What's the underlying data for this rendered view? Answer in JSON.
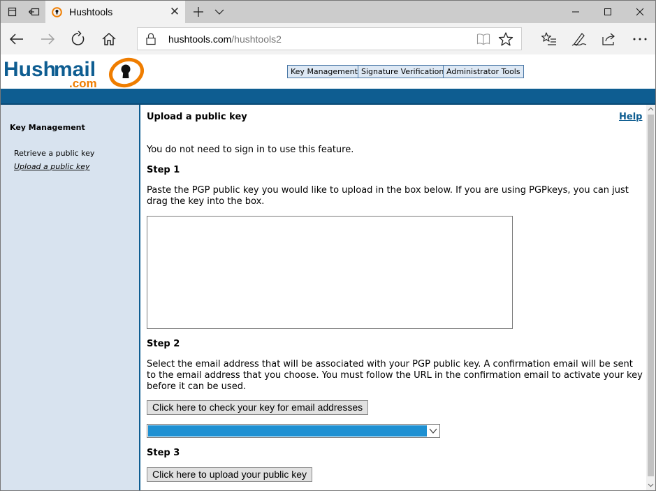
{
  "browser": {
    "tab_title": "Hushtools",
    "url_domain": "hushtools.com",
    "url_path": "/hushtools2",
    "close_tab_glyph": "✕"
  },
  "logo": {
    "brand_primary": "Hush",
    "brand_secondary": "mail",
    "domain": ".com",
    "colors": {
      "blue": "#0e5d91",
      "orange": "#ef7d00"
    }
  },
  "topnav": {
    "key_management": "Key Management",
    "signature_verification": "Signature Verification",
    "administrator_tools": "Administrator Tools"
  },
  "sidebar": {
    "heading": "Key Management",
    "items": [
      {
        "label": "Retrieve a public key",
        "active": false
      },
      {
        "label": "Upload a public key",
        "active": true
      }
    ]
  },
  "main": {
    "title": "Upload a public key",
    "help_label": "Help",
    "intro": "You do not need to sign in to use this feature.",
    "step1_heading": "Step 1",
    "step1_text": "Paste the PGP public key you would like to upload in the box below. If you are using PGPkeys, you can just drag the key into the box.",
    "key_box_value": "",
    "step2_heading": "Step 2",
    "step2_text": "Select the email address that will be associated with your PGP public key. A confirmation email will be sent to the email address that you choose. You must follow the URL in the confirmation email to activate your key before it can be used.",
    "check_button": "Click here to check your key for email addresses",
    "email_select_value": "",
    "step3_heading": "Step 3",
    "upload_button": "Click here to upload your public key"
  },
  "colors": {
    "header_bar": "#0e5d91",
    "sidebar_bg": "#d8e3ef",
    "select_highlight": "#1e90d2"
  },
  "icons": {
    "tabbar": [
      "tab-actions-icon",
      "set-aside-tabs-icon",
      "new-tab-plus-icon",
      "tab-menu-chevron-icon"
    ],
    "window": [
      "minimize-icon",
      "maximize-icon",
      "close-window-icon"
    ],
    "nav": [
      "back-arrow-icon",
      "forward-arrow-icon",
      "refresh-icon",
      "home-icon"
    ],
    "address": [
      "lock-icon",
      "reading-view-icon",
      "favorite-star-icon"
    ],
    "tools": [
      "favorites-list-icon",
      "notes-pen-icon",
      "share-icon",
      "more-dots-icon"
    ]
  }
}
